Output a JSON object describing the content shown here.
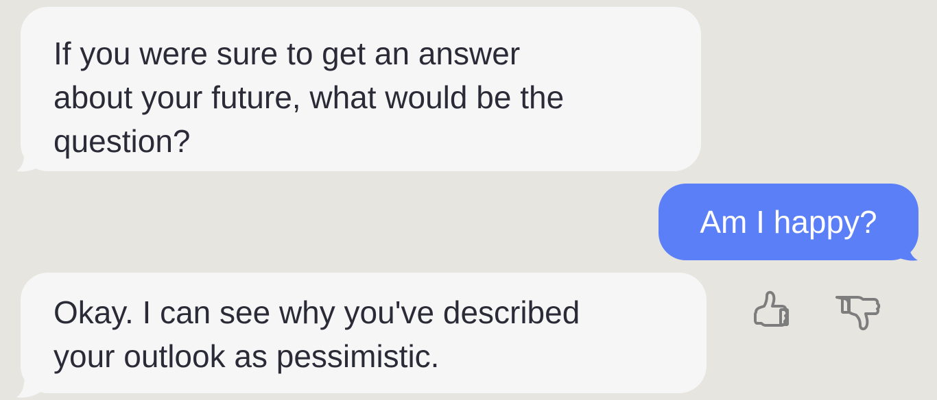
{
  "conversation": {
    "messages": [
      {
        "sender": "bot",
        "text": "If you were sure to get an answer\nabout your future, what would be the\nquestion?"
      },
      {
        "sender": "user",
        "text": "Am I happy?"
      },
      {
        "sender": "bot",
        "text": "Okay. I can see why you've described\nyour outlook as pessimistic."
      }
    ]
  },
  "feedback": {
    "thumbs_up_icon": "thumbs-up-icon",
    "thumbs_down_icon": "thumbs-down-icon"
  },
  "colors": {
    "background": "#e6e5df",
    "bot_bubble": "#f6f6f6",
    "user_bubble": "#5b7ff6",
    "bot_text": "#2b2b38",
    "user_text": "#ffffff",
    "icon": "#7d7d7d"
  }
}
